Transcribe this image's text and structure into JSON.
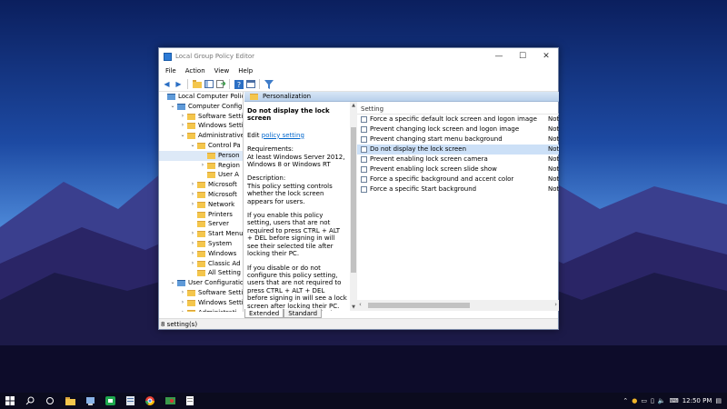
{
  "window": {
    "title": "Local Group Policy Editor",
    "minimize": "—",
    "maximize": "☐",
    "close": "✕"
  },
  "menu": [
    "File",
    "Action",
    "View",
    "Help"
  ],
  "tree": [
    {
      "label": "Local Computer Polic",
      "level": 0,
      "arrow": "",
      "icon": "pc"
    },
    {
      "label": "Computer Configu",
      "level": 1,
      "arrow": "⌄",
      "icon": "pc"
    },
    {
      "label": "Software Setti",
      "level": 2,
      "arrow": "›",
      "icon": "folder"
    },
    {
      "label": "Windows Setti",
      "level": 2,
      "arrow": "›",
      "icon": "folder"
    },
    {
      "label": "Administrative",
      "level": 2,
      "arrow": "⌄",
      "icon": "folder"
    },
    {
      "label": "Control Pa",
      "level": 3,
      "arrow": "⌄",
      "icon": "folder"
    },
    {
      "label": "Person",
      "level": 4,
      "arrow": "",
      "icon": "folder",
      "selected": true
    },
    {
      "label": "Region",
      "level": 4,
      "arrow": "›",
      "icon": "folder"
    },
    {
      "label": "User A",
      "level": 4,
      "arrow": "",
      "icon": "folder"
    },
    {
      "label": "Microsoft",
      "level": 3,
      "arrow": "›",
      "icon": "folder"
    },
    {
      "label": "Microsoft",
      "level": 3,
      "arrow": "›",
      "icon": "folder"
    },
    {
      "label": "Network",
      "level": 3,
      "arrow": "›",
      "icon": "folder"
    },
    {
      "label": "Printers",
      "level": 3,
      "arrow": "",
      "icon": "folder"
    },
    {
      "label": "Server",
      "level": 3,
      "arrow": "",
      "icon": "folder"
    },
    {
      "label": "Start Menu",
      "level": 3,
      "arrow": "›",
      "icon": "folder"
    },
    {
      "label": "System",
      "level": 3,
      "arrow": "›",
      "icon": "folder"
    },
    {
      "label": "Windows",
      "level": 3,
      "arrow": "›",
      "icon": "folder"
    },
    {
      "label": "Classic Ad",
      "level": 3,
      "arrow": "›",
      "icon": "folder"
    },
    {
      "label": "All Setting",
      "level": 3,
      "arrow": "",
      "icon": "folder"
    },
    {
      "label": "User Configuration",
      "level": 1,
      "arrow": "⌄",
      "icon": "pc"
    },
    {
      "label": "Software Setti",
      "level": 2,
      "arrow": "›",
      "icon": "folder"
    },
    {
      "label": "Windows Setti",
      "level": 2,
      "arrow": "›",
      "icon": "folder"
    },
    {
      "label": "Administrati",
      "level": 2,
      "arrow": "›",
      "icon": "folder"
    }
  ],
  "category": "Personalization",
  "description": {
    "title": "Do not display the lock screen",
    "edit_prefix": "Edit ",
    "edit_link": "policy setting",
    "req_label": "Requirements:",
    "req_text": "At least Windows Server 2012, Windows 8 or Windows RT",
    "desc_label": "Description:",
    "desc_text": "This policy setting controls whether the lock screen appears for users.",
    "p1": "If you enable this policy setting, users that are not required to press CTRL + ALT + DEL before signing in will see their selected tile after locking their PC.",
    "p2": "If you disable or do not configure this policy setting, users that are not required to press CTRL + ALT + DEL before signing in will see a lock screen after locking their PC. They must dismiss the lock screen"
  },
  "list": {
    "header": "Setting",
    "rows": [
      {
        "name": "Force a specific default lock screen and logon image",
        "state": "Not"
      },
      {
        "name": "Prevent changing lock screen and logon image",
        "state": "Not"
      },
      {
        "name": "Prevent changing start menu background",
        "state": "Not"
      },
      {
        "name": "Do not display the lock screen",
        "state": "Not",
        "selected": true
      },
      {
        "name": "Prevent enabling lock screen camera",
        "state": "Not"
      },
      {
        "name": "Prevent enabling lock screen slide show",
        "state": "Not"
      },
      {
        "name": "Force a specific background and accent color",
        "state": "Not"
      },
      {
        "name": "Force a specific Start background",
        "state": "Not"
      }
    ]
  },
  "tabs": [
    "Extended",
    "Standard"
  ],
  "status": "8 setting(s)",
  "taskbar": {
    "time": "12:50 PM"
  }
}
